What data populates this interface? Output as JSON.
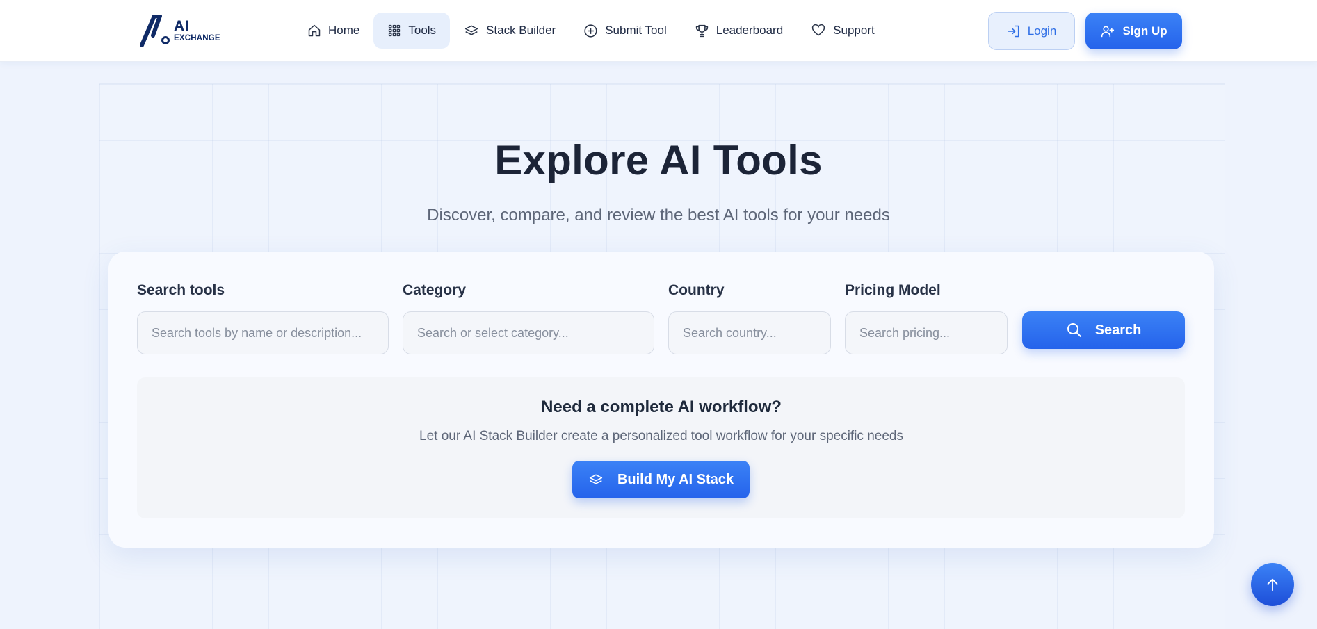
{
  "brand": {
    "name": "AI",
    "subtitle": "EXCHANGE",
    "primary_color": "#2563eb",
    "dark_color": "#0f2a66"
  },
  "nav": {
    "items": [
      {
        "label": "Home",
        "icon": "home-icon",
        "active": false
      },
      {
        "label": "Tools",
        "icon": "grid-icon",
        "active": true
      },
      {
        "label": "Stack Builder",
        "icon": "layers-icon",
        "active": false
      },
      {
        "label": "Submit Tool",
        "icon": "plus-circle-icon",
        "active": false
      },
      {
        "label": "Leaderboard",
        "icon": "trophy-icon",
        "active": false
      },
      {
        "label": "Support",
        "icon": "heart-icon",
        "active": false
      }
    ]
  },
  "auth": {
    "login_label": "Login",
    "signup_label": "Sign Up"
  },
  "hero": {
    "title": "Explore AI Tools",
    "subtitle": "Discover, compare, and review the best AI tools for your needs"
  },
  "search": {
    "tools_label": "Search tools",
    "tools_placeholder": "Search tools by name or description...",
    "category_label": "Category",
    "category_placeholder": "Search or select category...",
    "country_label": "Country",
    "country_placeholder": "Search country...",
    "pricing_label": "Pricing Model",
    "pricing_placeholder": "Search pricing...",
    "button_label": "Search"
  },
  "workflow": {
    "title": "Need a complete AI workflow?",
    "subtitle": "Let our AI Stack Builder create a personalized tool workflow for your specific needs",
    "button_label": "Build My AI Stack"
  }
}
